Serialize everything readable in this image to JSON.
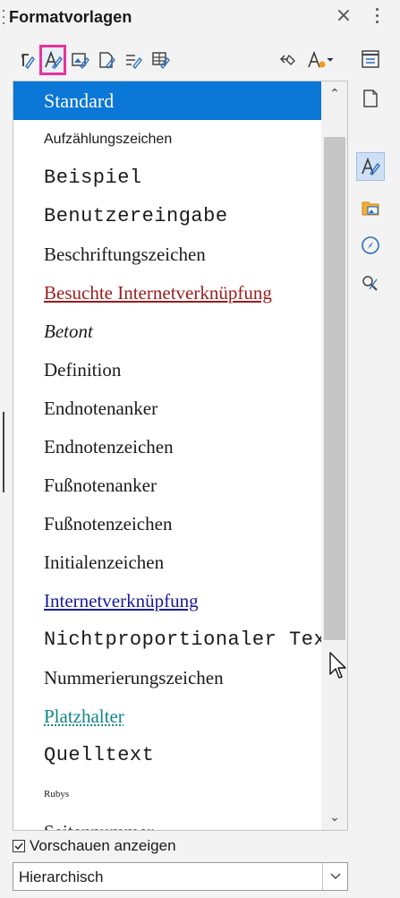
{
  "panel": {
    "title": "Formatvorlagen",
    "close_glyph": "×"
  },
  "toolbar": {
    "buttons": [
      {
        "name": "paragraph-styles-icon",
        "active": false
      },
      {
        "name": "character-styles-icon",
        "active": true
      },
      {
        "name": "frame-styles-icon",
        "active": false
      },
      {
        "name": "page-styles-icon",
        "active": false
      },
      {
        "name": "list-styles-icon",
        "active": false
      },
      {
        "name": "table-styles-icon",
        "active": false
      },
      {
        "name": "fill-format-mode-icon",
        "active": false
      },
      {
        "name": "new-style-icon",
        "active": false
      }
    ]
  },
  "styles": [
    {
      "label": "Standard",
      "selected": true,
      "font": "serif",
      "size": 22,
      "color": "#ffffff",
      "italic": false,
      "underline": false
    },
    {
      "label": "Aufzählungszeichen",
      "font": "sans",
      "size": 16,
      "color": "#1a1a1a"
    },
    {
      "label": "Beispiel",
      "font": "mono",
      "size": 22,
      "color": "#1a1a1a"
    },
    {
      "label": "Benutzereingabe",
      "font": "mono",
      "size": 22,
      "color": "#1a1a1a"
    },
    {
      "label": "Beschriftungszeichen",
      "font": "serif",
      "size": 21,
      "color": "#1a1a1a"
    },
    {
      "label": "Besuchte Internetverknüpfung",
      "font": "serif",
      "size": 21,
      "color": "#9b1c1c",
      "underline": true
    },
    {
      "label": "Betont",
      "font": "serif",
      "size": 21,
      "color": "#1a1a1a",
      "italic": true
    },
    {
      "label": "Definition",
      "font": "serif",
      "size": 21,
      "color": "#1a1a1a"
    },
    {
      "label": "Endnotenanker",
      "font": "serif",
      "size": 21,
      "color": "#1a1a1a"
    },
    {
      "label": "Endnotenzeichen",
      "font": "serif",
      "size": 21,
      "color": "#1a1a1a"
    },
    {
      "label": "Fußnotenanker",
      "font": "serif",
      "size": 21,
      "color": "#1a1a1a"
    },
    {
      "label": "Fußnotenzeichen",
      "font": "serif",
      "size": 21,
      "color": "#1a1a1a"
    },
    {
      "label": "Initialenzeichen",
      "font": "serif",
      "size": 21,
      "color": "#1a1a1a"
    },
    {
      "label": "Internetverknüpfung",
      "font": "serif",
      "size": 21,
      "color": "#1a1a96",
      "underline": true
    },
    {
      "label": "Nichtproportionaler Text",
      "font": "mono",
      "size": 22,
      "color": "#1a1a1a"
    },
    {
      "label": "Nummerierungszeichen",
      "font": "serif",
      "size": 21,
      "color": "#1a1a1a"
    },
    {
      "label": "Platzhalter",
      "font": "serif",
      "size": 21,
      "color": "#138585",
      "underline": true,
      "dotted": true
    },
    {
      "label": "Quelltext",
      "font": "mono",
      "size": 22,
      "color": "#1a1a1a"
    },
    {
      "label": "Rubys",
      "font": "serif",
      "size": 11,
      "color": "#1a1a1a"
    },
    {
      "label": "Seitennummer",
      "font": "serif",
      "size": 21,
      "color": "#1a1a1a"
    }
  ],
  "preview": {
    "label": "Vorschauen anzeigen",
    "checked": true
  },
  "filter": {
    "value": "Hierarchisch"
  },
  "sidebar": {
    "buttons": [
      {
        "name": "properties-icon",
        "active": false
      },
      {
        "name": "page-icon",
        "active": false
      },
      {
        "name": "styles-icon",
        "active": true
      },
      {
        "name": "gallery-icon",
        "active": false
      },
      {
        "name": "navigator-icon",
        "active": false
      },
      {
        "name": "style-inspector-icon",
        "active": false
      }
    ]
  },
  "colors": {
    "selection": "#0b77d6",
    "highlight": "#e8339b",
    "visited_link": "#9b1c1c",
    "link": "#1a1a96",
    "placeholder": "#138585"
  }
}
